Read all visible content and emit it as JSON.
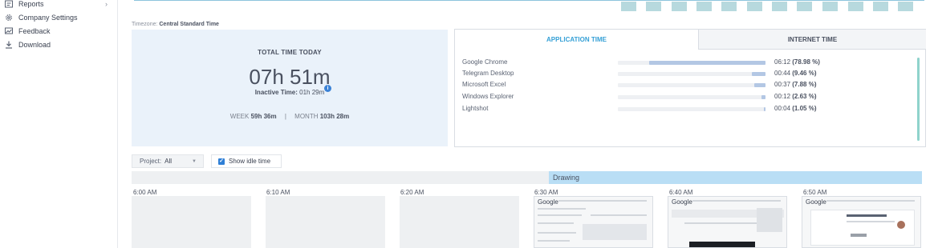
{
  "sidebar": {
    "items": [
      {
        "label": "Reports",
        "icon": "reports-icon",
        "chevron": "›"
      },
      {
        "label": "Company Settings",
        "icon": "gear-icon"
      },
      {
        "label": "Feedback",
        "icon": "feedback-icon"
      },
      {
        "label": "Download",
        "icon": "download-icon"
      }
    ]
  },
  "timezone": {
    "label": "Timezone:",
    "value": "Central Standard Time"
  },
  "total": {
    "label": "TOTAL TIME TODAY",
    "time": "07h 51m",
    "inactive_label": "Inactive Time:",
    "inactive_value": "01h 29m",
    "info_glyph": "i",
    "week_label": "WEEK",
    "week_value": "59h 36m",
    "separator": "|",
    "month_label": "MONTH",
    "month_value": "103h 28m"
  },
  "tabs": {
    "app": "APPLICATION TIME",
    "internet": "INTERNET TIME"
  },
  "apps": [
    {
      "name": "Google Chrome",
      "time": "06:12",
      "pct": "(78.98 %)",
      "share": 0.7898
    },
    {
      "name": "Telegram Desktop",
      "time": "00:44",
      "pct": "(9.46 %)",
      "share": 0.0946
    },
    {
      "name": "Microsoft Excel",
      "time": "00:37",
      "pct": "(7.88 %)",
      "share": 0.0788
    },
    {
      "name": "Windows Explorer",
      "time": "00:12",
      "pct": "(2.63 %)",
      "share": 0.0263
    },
    {
      "name": "Lightshot",
      "time": "00:04",
      "pct": "(1.05 %)",
      "share": 0.0105
    }
  ],
  "filters": {
    "project_label": "Project:",
    "project_value": "All",
    "idle_label": "Show idle time",
    "idle_checked": "✓"
  },
  "activity": {
    "label": "Drawing"
  },
  "slots": [
    {
      "time": "6:00 AM"
    },
    {
      "time": "6:10 AM"
    },
    {
      "time": "6:20 AM"
    },
    {
      "time": "6:30 AM",
      "title": "Google"
    },
    {
      "time": "6:40 AM",
      "title": "Google"
    },
    {
      "time": "6:50 AM",
      "title": "Google"
    }
  ],
  "colors": {
    "accent": "#35a0d6",
    "bar_fill": "#b3c7e4",
    "total_card_bg": "#eaf2fa",
    "activity_strip": "#b9def5"
  }
}
